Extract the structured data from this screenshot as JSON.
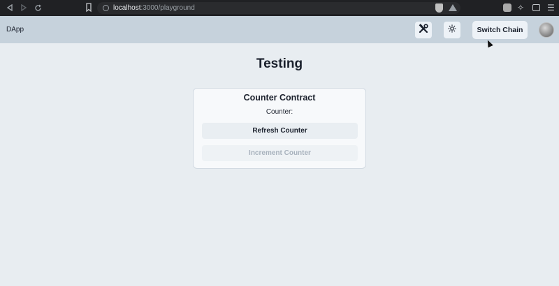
{
  "browser": {
    "url_host": "localhost",
    "url_rest": ":3000/playground",
    "icons": [
      "back-icon",
      "forward-icon",
      "reload-icon",
      "bookmark-icon",
      "brave-shield-icon",
      "brave-rewards-icon",
      "extension-icon",
      "puzzle-icon",
      "wallet-icon",
      "menu-icon"
    ]
  },
  "header": {
    "brand": "DApp",
    "switch_chain_label": "Switch Chain",
    "icons": [
      "tools-icon",
      "sun-icon"
    ]
  },
  "main": {
    "title": "Testing",
    "card": {
      "title": "Counter Contract",
      "counter_label": "Counter:",
      "refresh_label": "Refresh Counter",
      "increment_label": "Increment Counter"
    }
  },
  "colors": {
    "page_bg": "#e8edf1",
    "header_bg": "#c6d2dc",
    "browser_bg": "#202124",
    "disabled_text": "#a8b2bd"
  }
}
